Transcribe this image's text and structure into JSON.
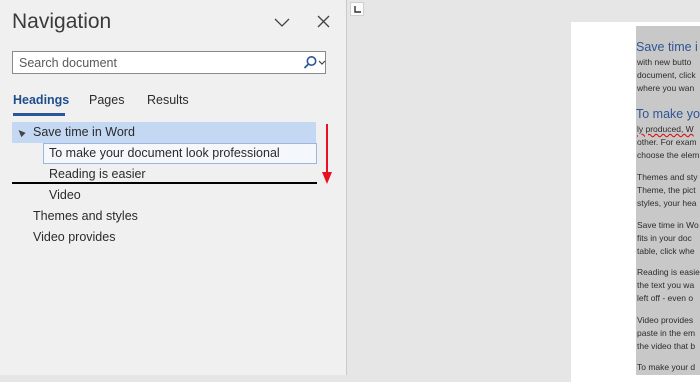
{
  "nav": {
    "title": "Navigation",
    "search": {
      "placeholder": "Search document"
    },
    "tabs": [
      {
        "label": "Headings",
        "active": true
      },
      {
        "label": "Pages",
        "active": false
      },
      {
        "label": "Results",
        "active": false
      }
    ],
    "tree": [
      {
        "label": "Save time in Word",
        "level": 1,
        "selected": true,
        "expanded": true
      },
      {
        "label": "To make your document look professional",
        "level": 2,
        "dragging": true
      },
      {
        "label": "Reading is easier",
        "level": 2
      },
      {
        "label": "Video",
        "level": 2
      },
      {
        "label": "Themes and styles",
        "level": 1
      },
      {
        "label": "Video provides",
        "level": 1
      }
    ]
  },
  "doc": {
    "heading1": "Save time i",
    "heading2": "To make yo",
    "lines": [
      "with new butto",
      "document, click",
      "where you wan",
      "ly produced, W",
      "other. For exam",
      "choose the elem",
      "Themes and sty",
      "Theme, the pict",
      "styles, your hea",
      "Save time in Wo",
      "fits in your doc",
      "table, click whe",
      "Reading is easie",
      "the text you wa",
      "left off - even o",
      "Video provides",
      "paste in the em",
      "the video that b",
      "To make your d"
    ]
  },
  "colors": {
    "accent": "#2b579a",
    "selected_row": "#c5d8f3",
    "drag_arrow": "#e81123",
    "heading_text": "#2f5597",
    "doc_selection": "#c8c8c8"
  },
  "icons": [
    "chevron-down-icon",
    "close-icon",
    "search-icon",
    "dropdown-icon",
    "collapse-triangle-icon",
    "ruler-tab-icon",
    "drag-arrow-icon"
  ]
}
